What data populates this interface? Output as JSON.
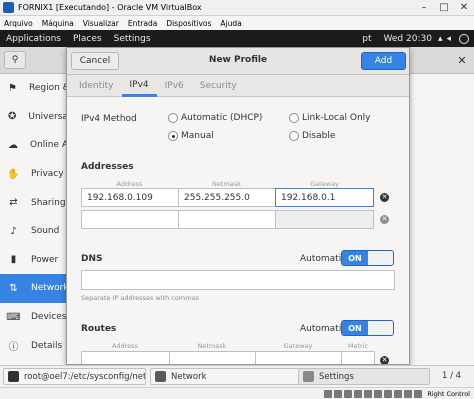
{
  "vbox": {
    "title": "FORNIX1 [Executando] - Oracle VM VirtualBox",
    "menu": [
      "Arquivo",
      "Máquina",
      "Visualizar",
      "Entrada",
      "Dispositivos",
      "Ajuda"
    ],
    "hostkey": "Right Control"
  },
  "gnome": {
    "applications": "Applications",
    "places": "Places",
    "settings": "Settings",
    "lang": "pt",
    "clock": "Wed 20:30"
  },
  "sidebar": {
    "items": [
      {
        "label": "Region & Language",
        "icon": "flag-icon"
      },
      {
        "label": "Universal Access",
        "icon": "accessibility-icon"
      },
      {
        "label": "Online Accounts",
        "icon": "cloud-icon"
      },
      {
        "label": "Privacy",
        "icon": "hand-icon"
      },
      {
        "label": "Sharing",
        "icon": "share-icon"
      },
      {
        "label": "Sound",
        "icon": "speaker-icon"
      },
      {
        "label": "Power",
        "icon": "power-icon"
      },
      {
        "label": "Network",
        "icon": "network-icon",
        "active": true
      },
      {
        "label": "Devices",
        "icon": "devices-icon"
      },
      {
        "label": "Details",
        "icon": "info-icon"
      }
    ]
  },
  "dialog": {
    "cancel": "Cancel",
    "title": "New Profile",
    "add": "Add",
    "tabs": [
      "Identity",
      "IPv4",
      "IPv6",
      "Security"
    ],
    "active_tab": "IPv4",
    "ipv4_method_label": "IPv4 Method",
    "methods": {
      "automatic_dhcp": "Automatic (DHCP)",
      "link_local": "Link-Local Only",
      "manual": "Manual",
      "disable": "Disable"
    },
    "selected_method": "Manual",
    "addresses_label": "Addresses",
    "address_columns": [
      "Address",
      "Netmask",
      "Gateway"
    ],
    "address_rows": [
      {
        "address": "192.168.0.109",
        "netmask": "255.255.255.0",
        "gateway": "192.168.0.1"
      },
      {
        "address": "",
        "netmask": "",
        "gateway": ""
      }
    ],
    "dns_label": "DNS",
    "dns_automatic_label": "Automatic",
    "dns_toggle": "ON",
    "dns_value": "",
    "dns_hint": "Separate IP addresses with commas",
    "routes_label": "Routes",
    "routes_automatic_label": "Automatic",
    "routes_toggle": "ON",
    "route_columns": [
      "Address",
      "Netmask",
      "Gateway",
      "Metric"
    ]
  },
  "taskbar": {
    "tasks": [
      {
        "label": "root@oel7:/etc/sysconfig/netwo..."
      },
      {
        "label": "Network"
      },
      {
        "label": "Settings"
      }
    ],
    "pager": "1 / 4"
  }
}
